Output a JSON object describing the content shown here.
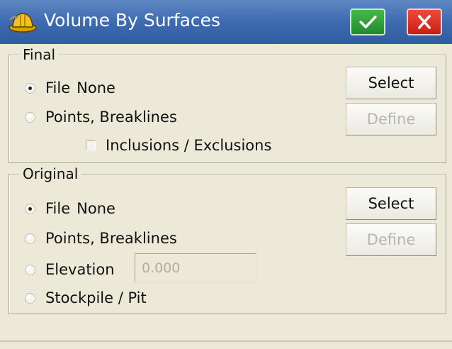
{
  "window": {
    "title": "Volume By Surfaces",
    "icons": {
      "app": "hard-hat-icon",
      "ok": "checkmark-icon",
      "close": "close-x-icon"
    },
    "colors": {
      "titlebar": "#3d6bb0",
      "ok_button": "#2e9e3a",
      "close_button": "#d9261c",
      "dialog_background": "#ece9d8",
      "disabled_text": "#b8b5ac"
    }
  },
  "final": {
    "label": "Final",
    "options": {
      "file": {
        "label": "File",
        "value": "None",
        "selected": true
      },
      "points_breaklines": {
        "label": "Points, Breaklines",
        "selected": false
      }
    },
    "inclusions_exclusions": {
      "label": "Inclusions / Exclusions",
      "checked": false
    },
    "select_label": "Select",
    "define_label": "Define",
    "define_enabled": false
  },
  "original": {
    "label": "Original",
    "options": {
      "file": {
        "label": "File",
        "value": "None",
        "selected": true
      },
      "points_breaklines": {
        "label": "Points, Breaklines",
        "selected": false
      },
      "elevation": {
        "label": "Elevation",
        "selected": false
      },
      "stockpile_pit": {
        "label": "Stockpile / Pit",
        "selected": false
      }
    },
    "elevation_value": "0.000",
    "elevation_enabled": false,
    "select_label": "Select",
    "define_label": "Define",
    "define_enabled": false
  }
}
